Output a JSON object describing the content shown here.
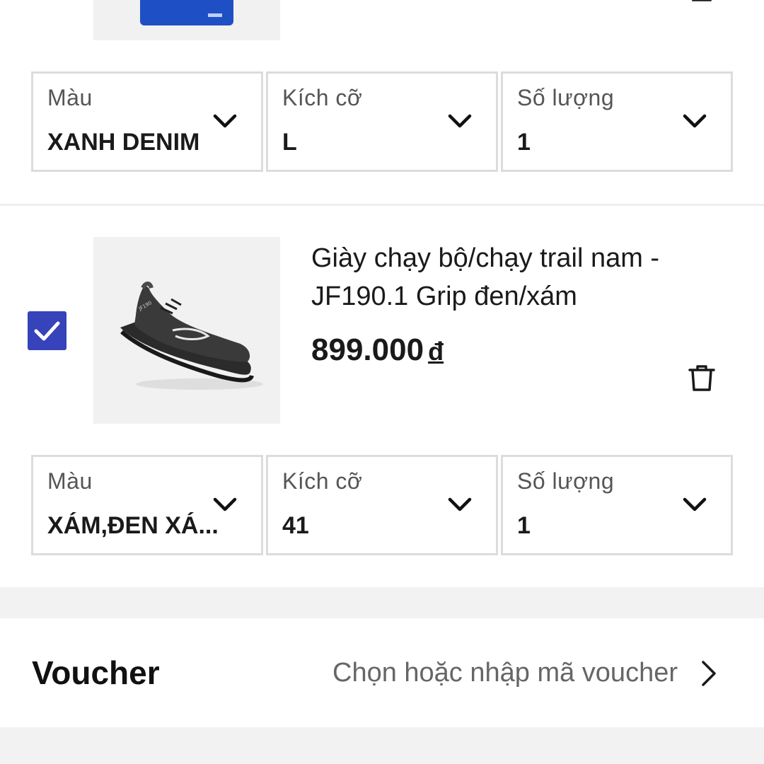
{
  "cart": {
    "items": [
      {
        "color_label": "Màu",
        "color_value": "XANH DENIM",
        "size_label": "Kích cỡ",
        "size_value": "L",
        "qty_label": "Số lượng",
        "qty_value": "1",
        "thumb_color": "#1f4fc4"
      },
      {
        "checked": true,
        "title_line1": "Giày chạy bộ/chạy trail nam -",
        "title_line2": "JF190.1 Grip đen/xám",
        "price": "899.000",
        "currency": "đ",
        "color_label": "Màu",
        "color_value": "XÁM,ĐEN XÁ...",
        "size_label": "Kích cỡ",
        "size_value": "41",
        "qty_label": "Số lượng",
        "qty_value": "1"
      }
    ]
  },
  "voucher": {
    "label": "Voucher",
    "hint": "Chọn hoặc nhập mã voucher"
  },
  "colors": {
    "accent": "#3643ba",
    "border": "#dcdcdc",
    "band": "#f2f2f2"
  },
  "icons": {
    "checkbox": "check-icon",
    "delete": "trash-icon",
    "dropdown": "chevron-down-icon",
    "voucher_open": "chevron-right-icon"
  }
}
